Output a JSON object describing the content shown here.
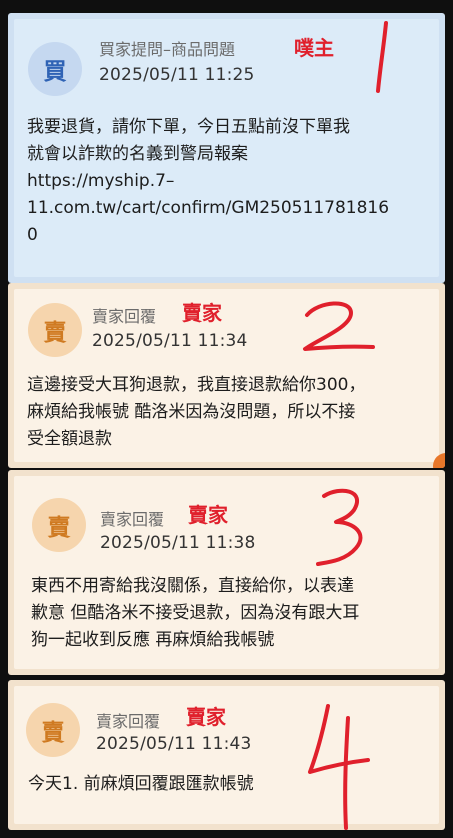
{
  "messages": [
    {
      "avatar_char": "買",
      "role": "買家提問–商品問題",
      "annotation": "噗主",
      "timestamp": "2025/05/11 11:25",
      "lines": [
        "我要退貨，請你下單，今日五點前沒下單我",
        "就會以詐欺的名義到警局報案",
        "https://myship.7–",
        "11.com.tw/cart/confirm/GM250511781816",
        "0"
      ],
      "number_mark": "1"
    },
    {
      "avatar_char": "賣",
      "role": "賣家回覆",
      "annotation": "賣家",
      "timestamp": "2025/05/11 11:34",
      "lines": [
        "這邊接受大耳狗退款，我直接退款給你300，",
        "麻煩給我帳號  酷洛米因為沒問題，所以不接",
        "受全額退款"
      ],
      "number_mark": "2"
    },
    {
      "avatar_char": "賣",
      "role": "賣家回覆",
      "annotation": "賣家",
      "timestamp": "2025/05/11 11:38",
      "lines": [
        "東西不用寄給我沒關係，直接給你，以表達",
        "歉意  但酷洛米不接受退款，因為沒有跟大耳",
        "狗一起收到反應  再麻煩給我帳號"
      ],
      "number_mark": "3"
    },
    {
      "avatar_char": "賣",
      "role": "賣家回覆",
      "annotation": "賣家",
      "timestamp": "2025/05/11 11:43",
      "lines": [
        "今天1. 前麻煩回覆跟匯款帳號"
      ],
      "number_mark": "4"
    }
  ],
  "colors": {
    "buyer_bg": "#dcebf8",
    "seller_bg": "#fbf2e6",
    "annotation_red": "#e0202c",
    "buyer_avatar": "#2f63b5",
    "seller_avatar": "#cf7a21"
  }
}
